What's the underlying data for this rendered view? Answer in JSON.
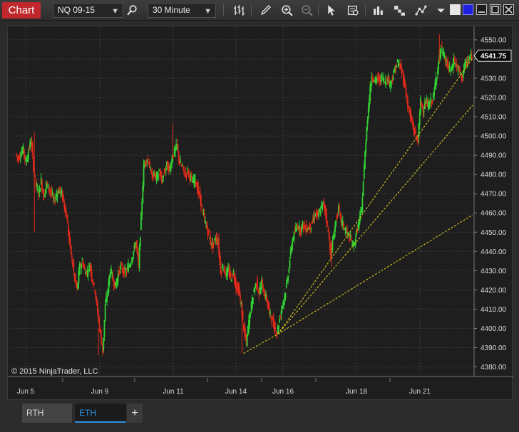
{
  "toolbar": {
    "chart_tab": "Chart",
    "instrument": "NQ 09-15",
    "interval": "30 Minute",
    "icons": [
      "search-icon",
      "bar-type-icon",
      "pencil-icon",
      "zoom-in-icon",
      "zoom-out-icon",
      "pointer-icon",
      "data-box-icon",
      "indicators-icon",
      "strategies-icon",
      "drawing-tools-icon",
      "menu-dropdown-icon",
      "minimize-icon",
      "maximize-icon",
      "close-icon"
    ]
  },
  "copyright": "© 2015 NinjaTrader, LLC",
  "tabs": {
    "rth": "RTH",
    "eth": "ETH",
    "add": "+"
  },
  "colors": {
    "up": "#33d133",
    "down": "#e02a1a",
    "fan": "#e6d21e",
    "grid": "#3a3a3a",
    "background": "#1e1e1e"
  },
  "chart_data": {
    "type": "candlestick",
    "instrument": "NQ 09-15",
    "interval": "30 Minute",
    "ylim": [
      4375,
      4557
    ],
    "y_ticks": [
      4380.0,
      4390.0,
      4400.0,
      4410.0,
      4420.0,
      4430.0,
      4440.0,
      4450.0,
      4460.0,
      4470.0,
      4480.0,
      4490.0,
      4500.0,
      4510.0,
      4520.0,
      4530.0,
      4540.0,
      4550.0
    ],
    "y_tick_labels": [
      "4380.00",
      "4390.00",
      "4400.00",
      "4410.00",
      "4420.00",
      "4430.00",
      "4440.00",
      "4450.00",
      "4460.00",
      "4470.00",
      "4480.00",
      "4490.00",
      "4500.00",
      "4510.00",
      "4520.00",
      "4530.00",
      "4540.00",
      "4550.00"
    ],
    "last_price": "4541.75",
    "x_labels": [
      "Jun 5",
      "Jun 9",
      "Jun 11",
      "Jun 14",
      "Jun 16",
      "Jun 18",
      "Jun 21"
    ],
    "price_path": [
      [
        0,
        4491
      ],
      [
        3,
        4488
      ],
      [
        6,
        4491
      ],
      [
        9,
        4493
      ],
      [
        12,
        4486
      ],
      [
        15,
        4492
      ],
      [
        18,
        4498
      ],
      [
        21,
        4484
      ],
      [
        24,
        4474
      ],
      [
        27,
        4470
      ],
      [
        30,
        4477
      ],
      [
        33,
        4468
      ],
      [
        36,
        4475
      ],
      [
        39,
        4473
      ],
      [
        42,
        4470
      ],
      [
        45,
        4466
      ],
      [
        48,
        4470
      ],
      [
        51,
        4472
      ],
      [
        54,
        4470
      ],
      [
        57,
        4464
      ],
      [
        60,
        4458
      ],
      [
        63,
        4445
      ],
      [
        66,
        4436
      ],
      [
        69,
        4426
      ],
      [
        72,
        4420
      ],
      [
        75,
        4432
      ],
      [
        78,
        4435
      ],
      [
        81,
        4430
      ],
      [
        84,
        4429
      ],
      [
        87,
        4433
      ],
      [
        90,
        4425
      ],
      [
        93,
        4420
      ],
      [
        96,
        4408
      ],
      [
        99,
        4398
      ],
      [
        102,
        4388
      ],
      [
        105,
        4412
      ],
      [
        108,
        4420
      ],
      [
        111,
        4431
      ],
      [
        114,
        4425
      ],
      [
        117,
        4422
      ],
      [
        120,
        4428
      ],
      [
        123,
        4432
      ],
      [
        126,
        4430
      ],
      [
        129,
        4429
      ],
      [
        132,
        4432
      ],
      [
        135,
        4435
      ],
      [
        138,
        4440
      ],
      [
        141,
        4445
      ],
      [
        144,
        4432
      ],
      [
        147,
        4458
      ],
      [
        150,
        4484
      ],
      [
        153,
        4488
      ],
      [
        156,
        4487
      ],
      [
        159,
        4479
      ],
      [
        162,
        4480
      ],
      [
        165,
        4478
      ],
      [
        168,
        4482
      ],
      [
        171,
        4476
      ],
      [
        174,
        4481
      ],
      [
        177,
        4485
      ],
      [
        180,
        4482
      ],
      [
        183,
        4488
      ],
      [
        186,
        4492
      ],
      [
        189,
        4495
      ],
      [
        192,
        4486
      ],
      [
        195,
        4484
      ],
      [
        198,
        4480
      ],
      [
        201,
        4482
      ],
      [
        204,
        4479
      ],
      [
        207,
        4476
      ],
      [
        210,
        4478
      ],
      [
        213,
        4472
      ],
      [
        216,
        4468
      ],
      [
        219,
        4460
      ],
      [
        222,
        4455
      ],
      [
        225,
        4450
      ],
      [
        228,
        4445
      ],
      [
        231,
        4443
      ],
      [
        234,
        4447
      ],
      [
        237,
        4445
      ],
      [
        240,
        4430
      ],
      [
        243,
        4432
      ],
      [
        246,
        4428
      ],
      [
        249,
        4430
      ],
      [
        252,
        4426
      ],
      [
        255,
        4429
      ],
      [
        258,
        4422
      ],
      [
        261,
        4420
      ],
      [
        264,
        4412
      ],
      [
        267,
        4400
      ],
      [
        270,
        4392
      ],
      [
        273,
        4404
      ],
      [
        276,
        4412
      ],
      [
        279,
        4420
      ],
      [
        282,
        4424
      ],
      [
        285,
        4418
      ],
      [
        288,
        4424
      ],
      [
        291,
        4418
      ],
      [
        294,
        4415
      ],
      [
        297,
        4408
      ],
      [
        300,
        4405
      ],
      [
        303,
        4400
      ],
      [
        306,
        4398
      ],
      [
        309,
        4405
      ],
      [
        312,
        4412
      ],
      [
        315,
        4417
      ],
      [
        318,
        4425
      ],
      [
        321,
        4436
      ],
      [
        324,
        4446
      ],
      [
        327,
        4450
      ],
      [
        330,
        4454
      ],
      [
        333,
        4451
      ],
      [
        336,
        4454
      ],
      [
        339,
        4452
      ],
      [
        342,
        4452
      ],
      [
        345,
        4453
      ],
      [
        348,
        4456
      ],
      [
        351,
        4460
      ],
      [
        354,
        4458
      ],
      [
        357,
        4462
      ],
      [
        360,
        4465
      ],
      [
        363,
        4460
      ],
      [
        366,
        4450
      ],
      [
        369,
        4438
      ],
      [
        372,
        4448
      ],
      [
        375,
        4456
      ],
      [
        378,
        4462
      ],
      [
        381,
        4456
      ],
      [
        384,
        4453
      ],
      [
        387,
        4450
      ],
      [
        390,
        4448
      ],
      [
        393,
        4445
      ],
      [
        396,
        4443
      ],
      [
        399,
        4450
      ],
      [
        402,
        4455
      ],
      [
        405,
        4462
      ],
      [
        408,
        4484
      ],
      [
        411,
        4505
      ],
      [
        414,
        4520
      ],
      [
        417,
        4532
      ],
      [
        420,
        4528
      ],
      [
        423,
        4530
      ],
      [
        426,
        4529
      ],
      [
        429,
        4531
      ],
      [
        432,
        4528
      ],
      [
        435,
        4530
      ],
      [
        438,
        4527
      ],
      [
        441,
        4530
      ],
      [
        444,
        4535
      ],
      [
        447,
        4538
      ],
      [
        450,
        4536
      ],
      [
        453,
        4532
      ],
      [
        456,
        4525
      ],
      [
        459,
        4516
      ],
      [
        462,
        4510
      ],
      [
        465,
        4505
      ],
      [
        468,
        4500
      ],
      [
        471,
        4498
      ],
      [
        474,
        4518
      ],
      [
        477,
        4514
      ],
      [
        480,
        4517
      ],
      [
        483,
        4516
      ],
      [
        486,
        4518
      ],
      [
        489,
        4520
      ],
      [
        492,
        4530
      ],
      [
        495,
        4538
      ],
      [
        498,
        4546
      ],
      [
        501,
        4542
      ],
      [
        504,
        4538
      ],
      [
        507,
        4535
      ],
      [
        510,
        4534
      ],
      [
        513,
        4540
      ],
      [
        516,
        4536
      ],
      [
        519,
        4534
      ],
      [
        522,
        4530
      ],
      [
        525,
        4536
      ],
      [
        528,
        4538
      ],
      [
        531,
        4540
      ],
      [
        534,
        4541.75
      ]
    ]
  }
}
